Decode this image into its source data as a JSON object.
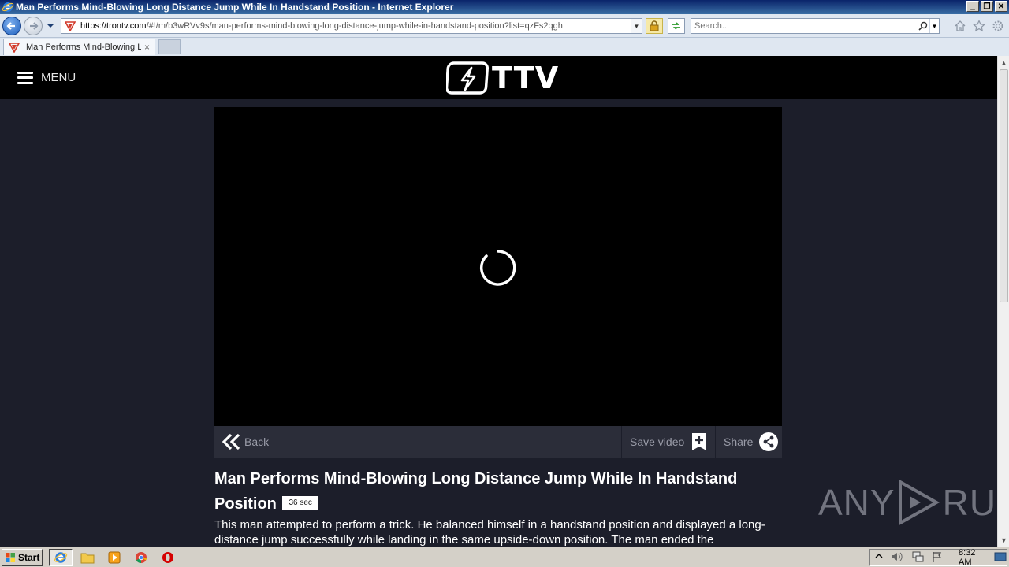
{
  "window": {
    "title": "Man Performs Mind-Blowing Long Distance Jump While In Handstand Position - Internet Explorer"
  },
  "browser": {
    "url_host": "https://trontv.com",
    "url_path": "/#!/m/b3wRVv9s/man-performs-mind-blowing-long-distance-jump-while-in-handstand-position?list=qzFs2qgh",
    "search_placeholder": "Search...",
    "tab_label": "Man Performs Mind-Blowing L...",
    "tab_close": "×"
  },
  "site": {
    "menu_label": "MENU",
    "logo_text": "TTV"
  },
  "video": {
    "back_label": "Back",
    "save_label": "Save video",
    "share_label": "Share",
    "title": "Man Performs Mind-Blowing Long Distance Jump While In Handstand Position",
    "duration": "36 sec",
    "description": "This man attempted to perform a trick. He balanced himself in a handstand position and displayed a long-distance jump successfully while landing in the same upside-down position. The man ended the"
  },
  "watermark": {
    "left": "ANY",
    "right": "RUN"
  },
  "taskbar": {
    "start_label": "Start",
    "clock": "8:32 AM"
  }
}
